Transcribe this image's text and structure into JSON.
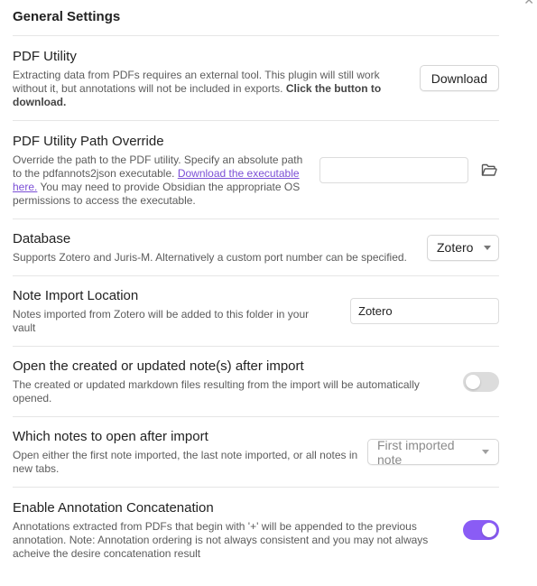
{
  "section": {
    "heading": "General Settings"
  },
  "pdf_utility": {
    "name": "PDF Utility",
    "desc_text": "Extracting data from PDFs requires an external tool. This plugin will still work without it, but annotations will not be included in exports. ",
    "desc_bold": "Click the button to download.",
    "button_label": "Download"
  },
  "path_override": {
    "name": "PDF Utility Path Override",
    "desc_before": "Override the path to the PDF utility. Specify an absolute path to the pdfannots2json executable. ",
    "desc_link": "Download the executable here.",
    "desc_after": " You may need to provide Obsidian the appropriate OS permissions to access the executable.",
    "input_value": "",
    "folder_icon": "folder-open-icon"
  },
  "database": {
    "name": "Database",
    "desc": "Supports Zotero and Juris-M. Alternatively a custom port number can be specified.",
    "selected": "Zotero"
  },
  "note_import": {
    "name": "Note Import Location",
    "desc": "Notes imported from Zotero will be added to this folder in your vault",
    "input_value": "Zotero"
  },
  "open_after_import": {
    "name": "Open the created or updated note(s) after import",
    "desc": "The created or updated markdown files resulting from the import will be automatically opened.",
    "enabled": false
  },
  "which_notes": {
    "name": "Which notes to open after import",
    "desc": "Open either the first note imported, the last note imported, or all notes in new tabs.",
    "selected": "First imported note"
  },
  "concatenation": {
    "name": "Enable Annotation Concatenation",
    "desc": "Annotations extracted from PDFs that begin with '+' will be appended to the previous annotation. Note: Annotation ordering is not always consistent and you may not always acheive the desire concatenation result",
    "enabled": true
  },
  "colors": {
    "accent": "#8a5cf5",
    "link": "#7b4fd6",
    "toggle_off": "#dcdcdc"
  }
}
